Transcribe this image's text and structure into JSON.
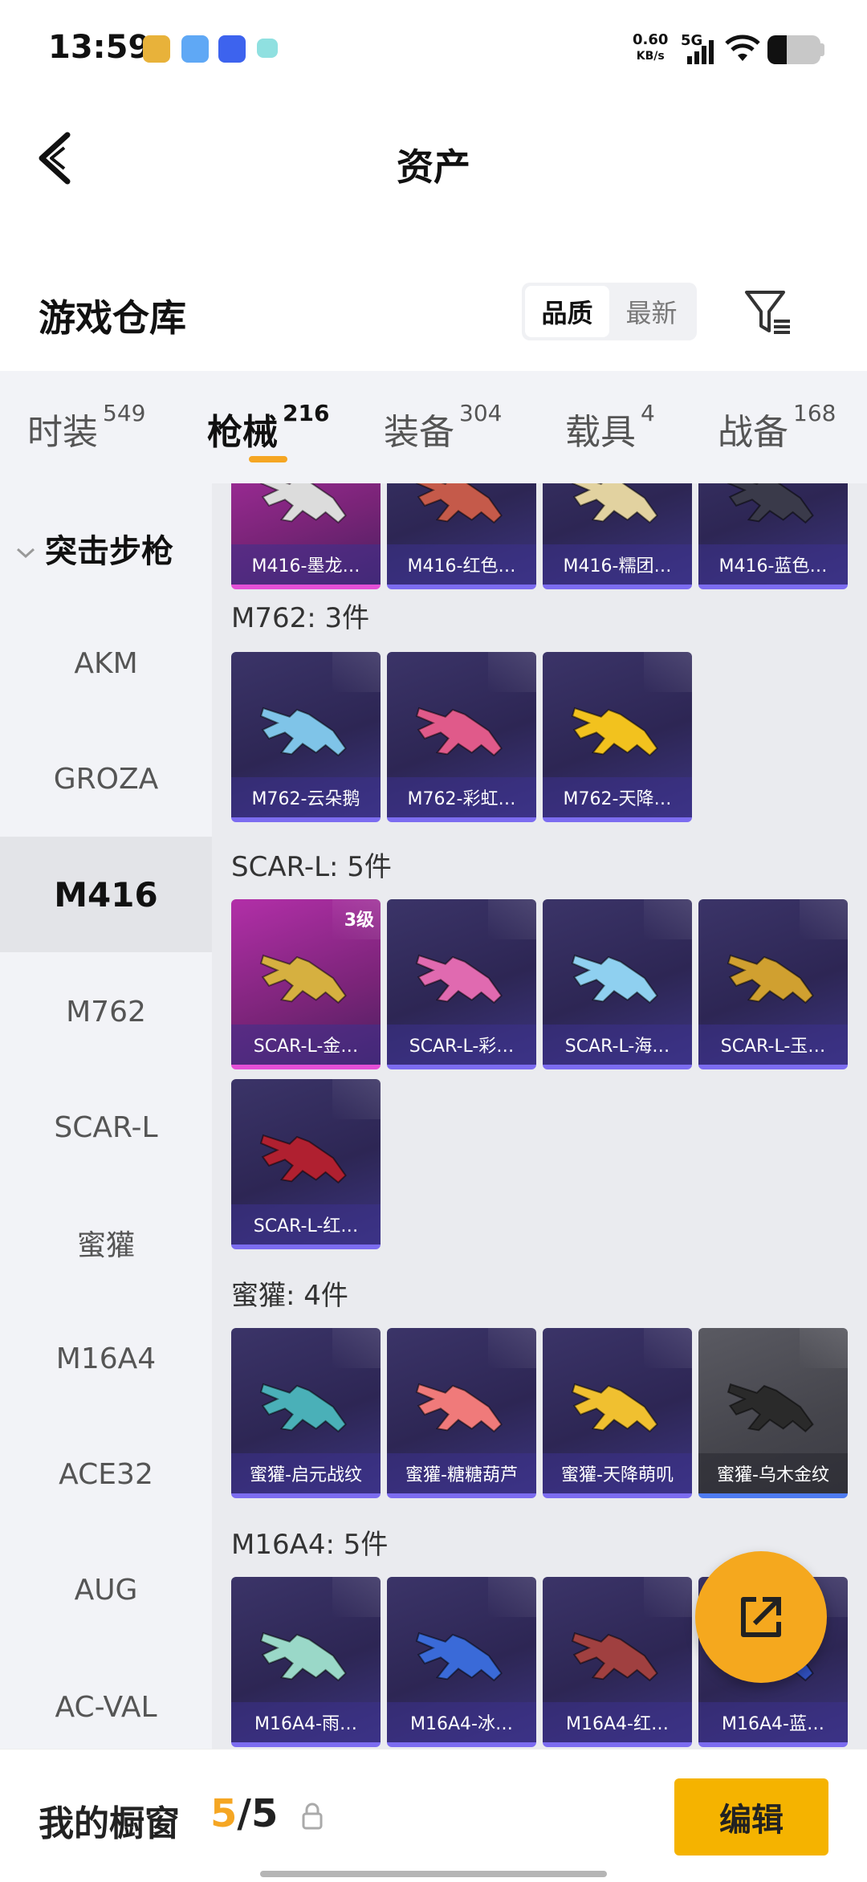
{
  "status": {
    "time": "13:59",
    "net_speed": "0.60",
    "net_unit": "KB/s",
    "network": "5G",
    "battery_level": 0.36
  },
  "header": {
    "title": "资产"
  },
  "warehouse": {
    "title": "游戏仓库",
    "sort_options": [
      "品质",
      "最新"
    ],
    "sort_selected": "品质"
  },
  "tabs": [
    {
      "label": "时装",
      "count": "549"
    },
    {
      "label": "枪械",
      "count": "216",
      "active": true
    },
    {
      "label": "装备",
      "count": "304"
    },
    {
      "label": "载具",
      "count": "4"
    },
    {
      "label": "战备",
      "count": "168"
    }
  ],
  "sidebar": {
    "category": "突击步枪",
    "items": [
      "AKM",
      "GROZA",
      "M416",
      "M762",
      "SCAR-L",
      "蜜獾",
      "M16A4",
      "ACE32",
      "AUG",
      "AC-VAL"
    ],
    "selected": "M416"
  },
  "groups": [
    {
      "label": "",
      "items": [
        {
          "name": "M416-墨龙…",
          "style": "pink",
          "gun_color": "#dcdcdc"
        },
        {
          "name": "M416-红色…",
          "style": "purple",
          "gun_color": "#c55a4a"
        },
        {
          "name": "M416-糯团…",
          "style": "purple",
          "gun_color": "#e2d2a0"
        },
        {
          "name": "M416-蓝色…",
          "style": "purple",
          "gun_color": "#3a3a4a"
        }
      ]
    },
    {
      "label": "M762: 3件",
      "items": [
        {
          "name": "M762-云朵鹅",
          "style": "purple",
          "gun_color": "#7fc4e8"
        },
        {
          "name": "M762-彩虹…",
          "style": "purple",
          "gun_color": "#e05a8a"
        },
        {
          "name": "M762-天降…",
          "style": "purple",
          "gun_color": "#f2c21e"
        }
      ]
    },
    {
      "label": "SCAR-L: 5件",
      "items": [
        {
          "name": "SCAR-L-金…",
          "style": "pink",
          "gun_color": "#d6b040",
          "level": "3级"
        },
        {
          "name": "SCAR-L-彩…",
          "style": "purple",
          "gun_color": "#e06ab0"
        },
        {
          "name": "SCAR-L-海…",
          "style": "purple",
          "gun_color": "#8fd0f0"
        },
        {
          "name": "SCAR-L-玉…",
          "style": "purple",
          "gun_color": "#d0a030"
        },
        {
          "name": "SCAR-L-红…",
          "style": "purple",
          "gun_color": "#b02030"
        }
      ]
    },
    {
      "label": "蜜獾: 4件",
      "items": [
        {
          "name": "蜜獾-启元战纹",
          "style": "purple",
          "gun_color": "#4ab0b8"
        },
        {
          "name": "蜜獾-糖糖葫芦",
          "style": "purple",
          "gun_color": "#f07a7a"
        },
        {
          "name": "蜜獾-天降萌叽",
          "style": "purple",
          "gun_color": "#f0c030"
        },
        {
          "name": "蜜獾-乌木金纹",
          "style": "gray",
          "gun_color": "#2a2a2a"
        }
      ]
    },
    {
      "label": "M16A4: 5件",
      "items": [
        {
          "name": "M16A4-雨…",
          "style": "purple",
          "gun_color": "#9ad8c8"
        },
        {
          "name": "M16A4-冰…",
          "style": "purple",
          "gun_color": "#3a6ad8"
        },
        {
          "name": "M16A4-红…",
          "style": "purple",
          "gun_color": "#a04040"
        },
        {
          "name": "M16A4-蓝…",
          "style": "purple",
          "gun_color": "#3050c0"
        }
      ]
    }
  ],
  "bottom": {
    "showcase_label": "我的橱窗",
    "showcase_current": "5",
    "showcase_separator": "/",
    "showcase_total": "5",
    "edit_label": "编辑"
  },
  "colors": {
    "accent": "#f5a623",
    "edit_button": "#f5b300",
    "fab": "#f5a81e"
  },
  "icons": {
    "back": "chevron-left-icon",
    "filter": "filter-icon",
    "fab": "share-icon",
    "lock": "lock-icon"
  }
}
